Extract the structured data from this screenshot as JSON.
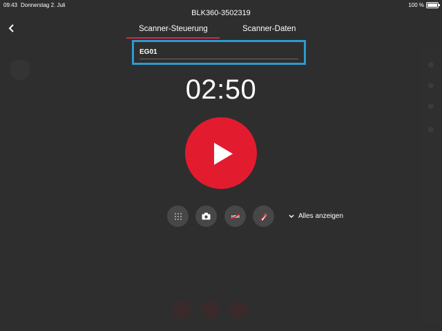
{
  "status_bar": {
    "time": "09:43",
    "date": "Donnerstag 2. Juli",
    "battery": "100 %"
  },
  "header": {
    "device_title": "BLK360-3502319",
    "back_icon": "chevron-left-icon"
  },
  "tabs": [
    {
      "label": "Scanner-Steuerung",
      "active": true
    },
    {
      "label": "Scanner-Daten",
      "active": false
    }
  ],
  "scan_name": {
    "value": "EG01"
  },
  "timer": {
    "value": "02:50"
  },
  "options": {
    "show_all_label": "Alles anzeigen",
    "hdr_label": "HDR"
  },
  "colors": {
    "background": "#2e2e2e",
    "accent_red": "#e21b2f",
    "field_highlight": "#2b9bd3",
    "tab_underline": "#e0253a"
  }
}
